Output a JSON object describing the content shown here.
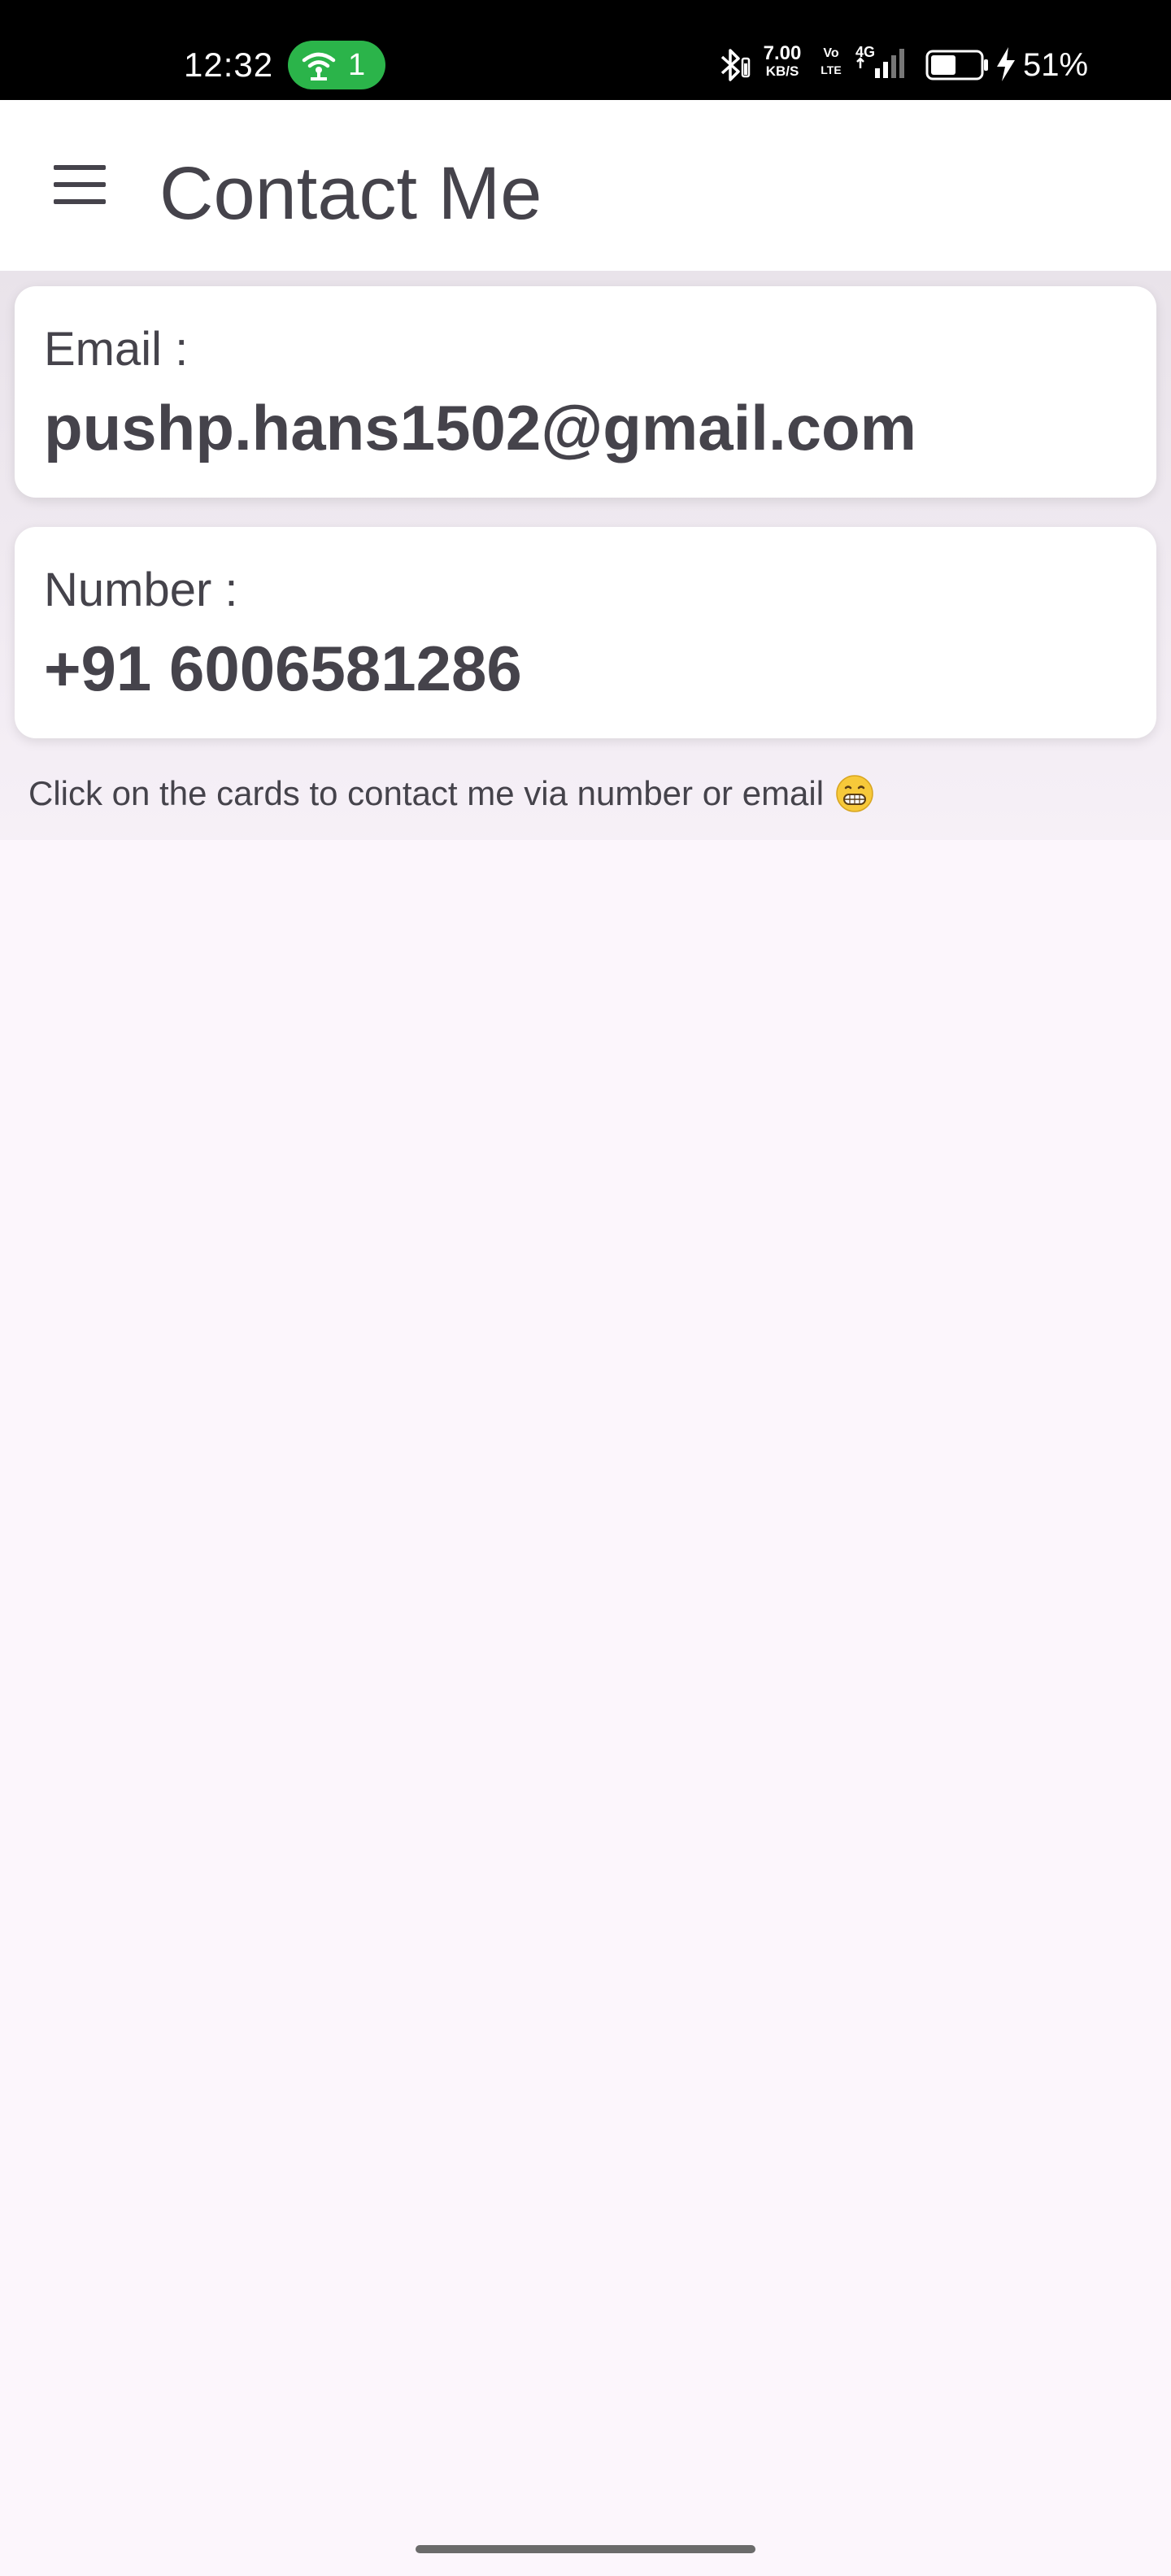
{
  "status_bar": {
    "time": "12:32",
    "hotspot_count": "1",
    "net_speed_value": "7.00",
    "net_speed_unit": "KB/S",
    "volte_top": "Vo",
    "volte_bottom": "LTE",
    "network_type": "4G",
    "battery_level": 0.51,
    "battery_percent": "51%",
    "icons": [
      "hotspot-icon",
      "bluetooth-icon",
      "signal-icon",
      "battery-icon",
      "charging-icon"
    ]
  },
  "app_bar": {
    "title": "Contact Me",
    "menu_icon": "hamburger-menu-icon"
  },
  "cards": {
    "email": {
      "label": "Email :",
      "value": "pushp.hans1502@gmail.com"
    },
    "number": {
      "label": "Number :",
      "value": "+91 6006581286"
    }
  },
  "hint": {
    "text": "Click on the cards to contact me via number or email",
    "emoji_icon": "grinning-face-icon"
  },
  "colors": {
    "text": "#45434b",
    "page_background": "#fcf6fc",
    "card_background": "#ffffff",
    "hotspot_green": "#2bb44a"
  }
}
